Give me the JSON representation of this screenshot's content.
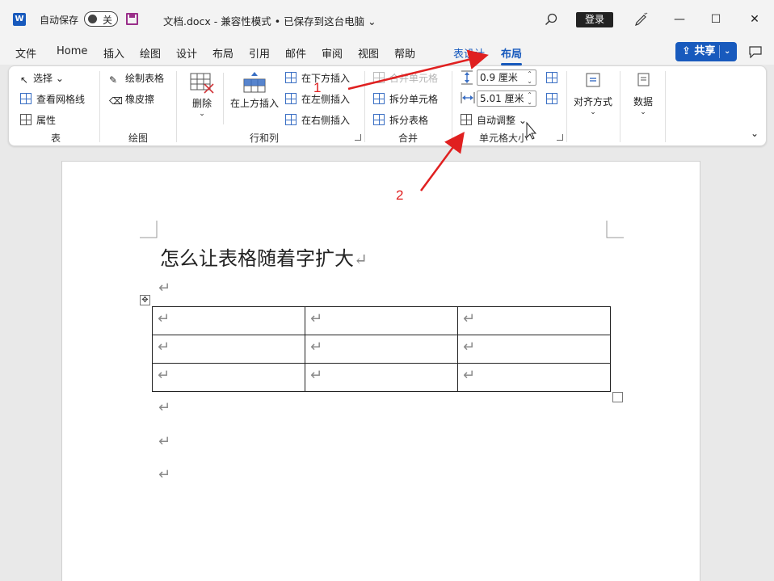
{
  "title_bar": {
    "app_icon": "word-icon",
    "autosave_label": "自动保存",
    "autosave_state": "关",
    "document_title": "文档.docx  -  兼容性模式 • 已保存到这台电脑 ⌄",
    "login_label": "登录",
    "minimize": "—",
    "maximize": "☐",
    "close": "✕"
  },
  "tabs": [
    {
      "label": "文件"
    },
    {
      "label": "Home"
    },
    {
      "label": "插入"
    },
    {
      "label": "绘图"
    },
    {
      "label": "设计"
    },
    {
      "label": "布局"
    },
    {
      "label": "引用"
    },
    {
      "label": "邮件"
    },
    {
      "label": "审阅"
    },
    {
      "label": "视图"
    },
    {
      "label": "帮助"
    },
    {
      "label": "表设计"
    },
    {
      "label": "布局"
    }
  ],
  "share_label": "共享",
  "ribbon": {
    "table_group": {
      "select": "选择",
      "view_gridlines": "查看网格线",
      "properties": "属性",
      "label": "表"
    },
    "draw_group": {
      "draw_table": "绘制表格",
      "eraser": "橡皮擦",
      "label": "绘图"
    },
    "rows_cols_group": {
      "delete": "删除",
      "insert_above": "在上方插入",
      "insert_below": "在下方插入",
      "insert_left": "在左侧插入",
      "insert_right": "在右侧插入",
      "label": "行和列"
    },
    "merge_group": {
      "merge_cells": "合并单元格",
      "split_cells": "拆分单元格",
      "split_table": "拆分表格",
      "label": "合并"
    },
    "cell_size_group": {
      "height_value": "0.9 厘米",
      "width_value": "5.01 厘米",
      "autofit": "自动调整",
      "label": "单元格大小"
    },
    "alignment": "对齐方式",
    "data": "数据"
  },
  "document": {
    "heading": "怎么让表格随着字扩大",
    "paragraph_mark": "↵",
    "table_rows": [
      [
        "↵",
        "↵",
        "↵"
      ],
      [
        "↵",
        "↵",
        "↵"
      ],
      [
        "↵",
        "↵",
        "↵"
      ]
    ]
  },
  "annotations": {
    "arrow_1_label": "1",
    "arrow_2_label": "2",
    "color": "#e02020"
  },
  "colors": {
    "accent": "#185abd",
    "word_brand": "#185abd"
  }
}
